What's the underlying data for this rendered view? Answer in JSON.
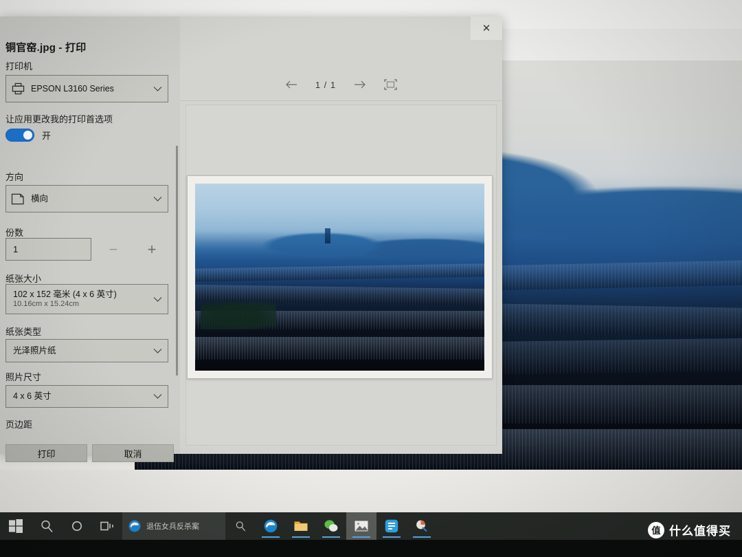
{
  "dialog": {
    "title": "铜官窑.jpg - 打印",
    "close_label": "✕",
    "sections": {
      "printer_label": "打印机",
      "printer_value": "EPSON L3160 Series",
      "preferences_label": "让应用更改我的打印首选项",
      "toggle_state": "开",
      "orientation_label": "方向",
      "orientation_value": "横向",
      "copies_label": "份数",
      "copies_value": "1",
      "minus_label": "−",
      "plus_label": "+",
      "paper_size_label": "纸张大小",
      "paper_size_value": "102 x 152 毫米 (4 x 6 英寸)",
      "paper_size_sub": "10.16cm x 15.24cm",
      "paper_type_label": "纸张类型",
      "paper_type_value": "光泽照片纸",
      "photo_size_label": "照片尺寸",
      "photo_size_value": "4 x 6 英寸",
      "margins_label": "页边距"
    },
    "buttons": {
      "print": "打印",
      "cancel": "取消"
    },
    "preview": {
      "page_indicator": "1 / 1",
      "prev_icon": "←",
      "next_icon": "→",
      "fit_icon": "fit-to-page-icon"
    }
  },
  "photos_app": {
    "crop_icon": "crop-icon",
    "edit_icon": "pen-icon"
  },
  "taskbar": {
    "start_icon": "windows-start-icon",
    "search_icon": "search-icon",
    "cortana_icon": "cortana-circle-icon",
    "taskview_icon": "task-view-icon",
    "news": {
      "headline": "退伍女兵反杀案",
      "browser_icon": "edge-icon",
      "search_icon": "search-icon"
    },
    "apps": [
      {
        "name": "edge",
        "label": "Microsoft Edge"
      },
      {
        "name": "file-explorer",
        "label": "文件资源管理器"
      },
      {
        "name": "wechat",
        "label": "微信"
      },
      {
        "name": "photos",
        "label": "照片"
      },
      {
        "name": "blue-app",
        "label": "酷狗"
      },
      {
        "name": "misc-app",
        "label": "应用"
      }
    ]
  },
  "watermark": {
    "logo": "值",
    "text": "什么值得买"
  },
  "colors": {
    "accent": "#1b74d0",
    "dialog_bg": "#cdcdc9",
    "preview_bg": "#d5d5d1",
    "taskbar": "#262a27",
    "underline": "#5aa9e6"
  }
}
